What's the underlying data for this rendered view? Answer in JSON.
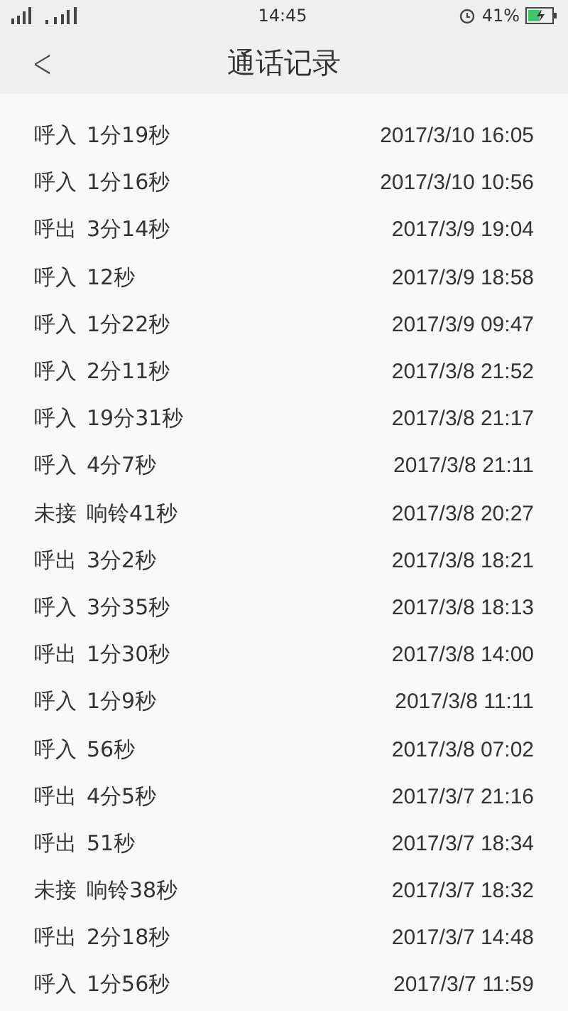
{
  "status_bar": {
    "time": "14:45",
    "battery": "41%"
  },
  "header": {
    "back": "<",
    "title": "通话记录"
  },
  "calls": [
    {
      "type": "呼入",
      "duration": "1分19秒",
      "time": "2017/3/10 16:05"
    },
    {
      "type": "呼入",
      "duration": "1分16秒",
      "time": "2017/3/10 10:56"
    },
    {
      "type": "呼出",
      "duration": "3分14秒",
      "time": "2017/3/9 19:04"
    },
    {
      "type": "呼入",
      "duration": "12秒",
      "time": "2017/3/9 18:58"
    },
    {
      "type": "呼入",
      "duration": "1分22秒",
      "time": "2017/3/9 09:47"
    },
    {
      "type": "呼入",
      "duration": "2分11秒",
      "time": "2017/3/8 21:52"
    },
    {
      "type": "呼入",
      "duration": "19分31秒",
      "time": "2017/3/8 21:17"
    },
    {
      "type": "呼入",
      "duration": "4分7秒",
      "time": "2017/3/8 21:11"
    },
    {
      "type": "未接",
      "duration": "响铃41秒",
      "time": "2017/3/8 20:27"
    },
    {
      "type": "呼出",
      "duration": "3分2秒",
      "time": "2017/3/8 18:21"
    },
    {
      "type": "呼入",
      "duration": "3分35秒",
      "time": "2017/3/8 18:13"
    },
    {
      "type": "呼出",
      "duration": "1分30秒",
      "time": "2017/3/8 14:00"
    },
    {
      "type": "呼入",
      "duration": "1分9秒",
      "time": "2017/3/8 11:11"
    },
    {
      "type": "呼入",
      "duration": "56秒",
      "time": "2017/3/8 07:02"
    },
    {
      "type": "呼出",
      "duration": "4分5秒",
      "time": "2017/3/7 21:16"
    },
    {
      "type": "呼出",
      "duration": "51秒",
      "time": "2017/3/7 18:34"
    },
    {
      "type": "未接",
      "duration": "响铃38秒",
      "time": "2017/3/7 18:32"
    },
    {
      "type": "呼出",
      "duration": "2分18秒",
      "time": "2017/3/7 14:48"
    },
    {
      "type": "呼入",
      "duration": "1分56秒",
      "time": "2017/3/7 11:59"
    }
  ]
}
